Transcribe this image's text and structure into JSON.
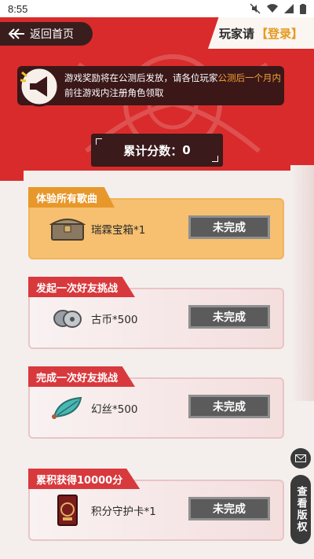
{
  "status_bar": {
    "time": "8:55"
  },
  "header": {
    "back_label": "返回首页",
    "login_prefix": "玩家请",
    "login_link": "【登录】"
  },
  "notice": {
    "line1_a": "游戏奖励将在公测后发放，请各位玩家",
    "line1_highlight": "公测后一个月内",
    "line2": "前往游戏内注册角色领取"
  },
  "score": {
    "label": "累计分数：",
    "value": "0"
  },
  "tasks": [
    {
      "title": "体验所有歌曲",
      "reward": "瑞霖宝箱*1",
      "status": "未完成",
      "icon": "treasure-chest-icon"
    },
    {
      "title": "发起一次好友挑战",
      "reward": "古币*500",
      "status": "未完成",
      "icon": "coin-icon"
    },
    {
      "title": "完成一次好友挑战",
      "reward": "幻丝*500",
      "status": "未完成",
      "icon": "silk-icon"
    },
    {
      "title": "累积获得10000分",
      "reward": "积分守护卡*1",
      "status": "未完成",
      "icon": "guard-card-icon"
    }
  ],
  "side": {
    "copyright_label": "查看版权"
  },
  "colors": {
    "banner_red": "#d92b2b",
    "accent_orange": "#e8972a",
    "dark": "#3a1a1b"
  }
}
